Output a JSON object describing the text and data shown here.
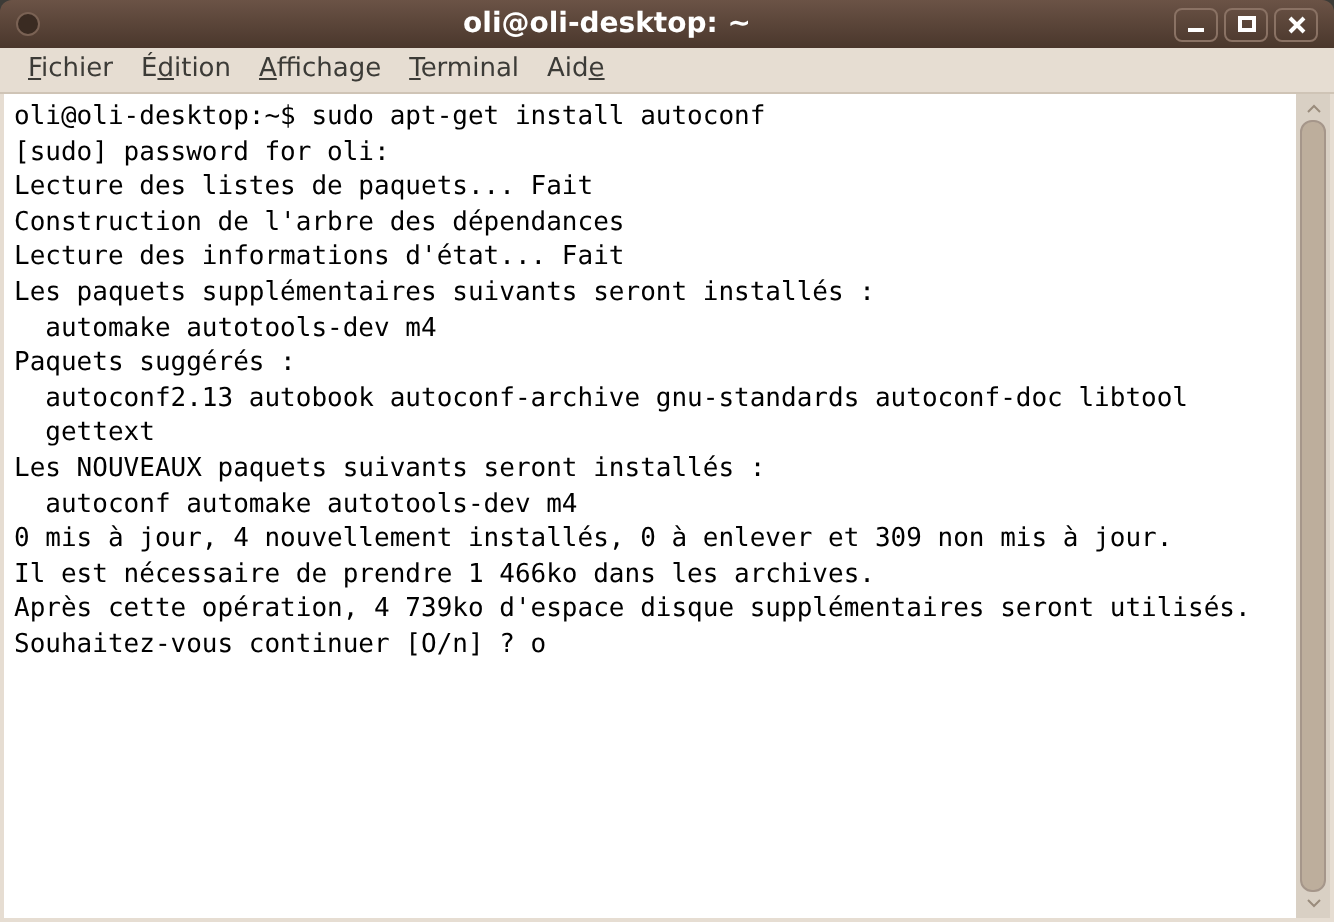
{
  "window": {
    "title": "oli@oli-desktop: ~"
  },
  "menu": [
    {
      "parts": [
        {
          "text": "F",
          "underlined": true
        },
        {
          "text": "ichier",
          "underlined": false
        }
      ]
    },
    {
      "parts": [
        {
          "text": "É",
          "underlined": false
        },
        {
          "text": "d",
          "underlined": true
        },
        {
          "text": "ition",
          "underlined": false
        }
      ]
    },
    {
      "parts": [
        {
          "text": "A",
          "underlined": true
        },
        {
          "text": "ffichage",
          "underlined": false
        }
      ]
    },
    {
      "parts": [
        {
          "text": "T",
          "underlined": true
        },
        {
          "text": "erminal",
          "underlined": false
        }
      ]
    },
    {
      "parts": [
        {
          "text": "Aid",
          "underlined": false
        },
        {
          "text": "e",
          "underlined": true
        }
      ]
    }
  ],
  "terminal": {
    "lines": [
      "oli@oli-desktop:~$ sudo apt-get install autoconf",
      "[sudo] password for oli:",
      "Lecture des listes de paquets... Fait",
      "Construction de l'arbre des dépendances",
      "Lecture des informations d'état... Fait",
      "Les paquets supplémentaires suivants seront installés :",
      "  automake autotools-dev m4",
      "Paquets suggérés :",
      "  autoconf2.13 autobook autoconf-archive gnu-standards autoconf-doc libtool",
      "  gettext",
      "Les NOUVEAUX paquets suivants seront installés :",
      "  autoconf automake autotools-dev m4",
      "0 mis à jour, 4 nouvellement installés, 0 à enlever et 309 non mis à jour.",
      "Il est nécessaire de prendre 1 466ko dans les archives.",
      "Après cette opération, 4 739ko d'espace disque supplémentaires seront utilisés.",
      "Souhaitez-vous continuer [O/n] ? o"
    ]
  }
}
